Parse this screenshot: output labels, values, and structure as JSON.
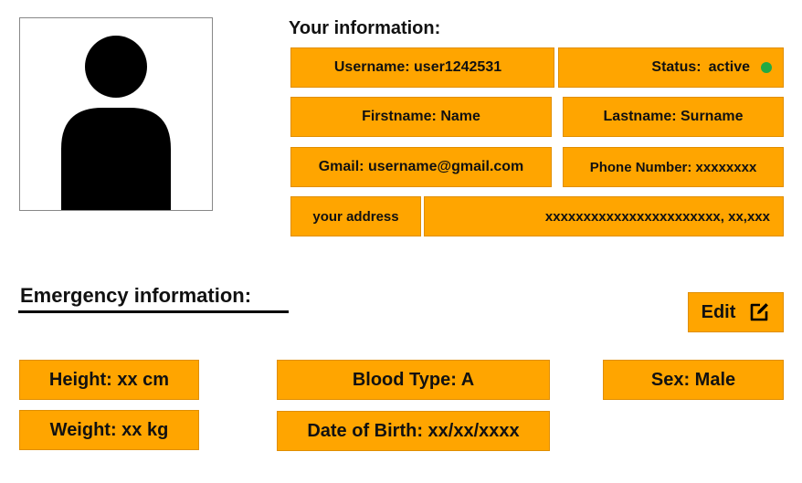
{
  "your_info": {
    "heading": "Your information:",
    "username": "Username: user1242531",
    "status_label": "Status:",
    "status_value": "active",
    "status_color": "#22aa44",
    "firstname": "Firstname: Name",
    "lastname": "Lastname: Surname",
    "gmail": "Gmail: username@gmail.com",
    "phone": "Phone Number: xxxxxxxx",
    "address_label": "your address",
    "address_value": "xxxxxxxxxxxxxxxxxxxxxxx, xx,xxx"
  },
  "emergency": {
    "heading": "Emergency information:",
    "edit_label": "Edit",
    "height": "Height: xx cm",
    "weight": "Weight: xx kg",
    "blood_type": "Blood Type: A",
    "date_of_birth": "Date of Birth: xx/xx/xxxx",
    "sex": "Sex: Male"
  },
  "colors": {
    "field_background": "#ffa500",
    "text": "#111111"
  },
  "icons": {
    "avatar": "person-avatar-icon",
    "edit": "edit-icon"
  }
}
